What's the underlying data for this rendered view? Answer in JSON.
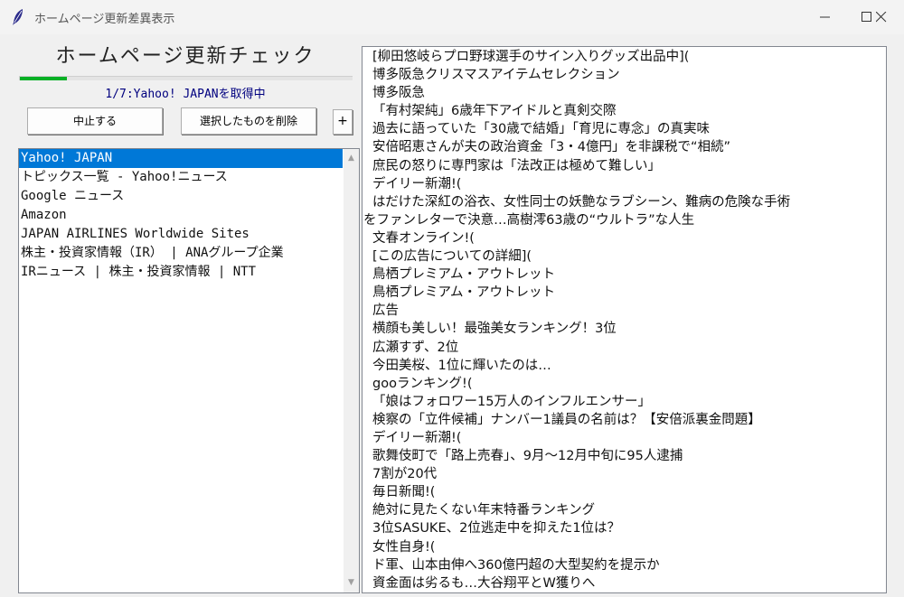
{
  "window": {
    "title": "ホームページ更新差異表示",
    "icon": "feather-icon"
  },
  "heading": "ホームページ更新チェック",
  "progress": {
    "value": 0.14,
    "color": "#06b025"
  },
  "status": "1/7:Yahoo! JAPANを取得中",
  "buttons": {
    "stop": "中止する",
    "delete": "選択したものを削除",
    "add": "+"
  },
  "sites": [
    "Yahoo! JAPAN",
    "トピックス一覧 - Yahoo!ニュース",
    "Google ニュース",
    "Amazon",
    "JAPAN AIRLINES Worldwide Sites",
    "株主・投資家情報（IR） | ANAグループ企業",
    "IRニュース | 株主・投資家情報 | NTT"
  ],
  "selected_site_index": 0,
  "diff_lines": [
    "[柳田悠岐らプロ野球選手のサイン入りグッズ出品中](",
    "博多阪急クリスマスアイテムセレクション",
    "博多阪急",
    "「有村架純」6歳年下アイドルと真剣交際",
    "過去に語っていた「30歳で結婚」「育児に専念」の真実味",
    "安倍昭恵さんが夫の政治資金「3・4億円」を非課税で“相続”",
    "庶民の怒りに専門家は「法改正は極めて難しい」",
    "デイリー新潮!(",
    "はだけた深紅の浴衣、女性同士の妖艶なラブシーン、難病の危険な手術",
    "をファンレターで決意…高樹澪63歳の“ウルトラ”な人生",
    "文春オンライン!(",
    "[この広告についての詳細](",
    "鳥栖プレミアム・アウトレット",
    "鳥栖プレミアム・アウトレット",
    "広告",
    "横顔も美しい！最強美女ランキング！3位",
    "広瀬すず、2位",
    "今田美桜、1位に輝いたのは…",
    "gooランキング!(",
    "「娘はフォロワー15万人のインフルエンサー」",
    "検察の「立件候補」ナンバー1議員の名前は？【安倍派裏金問題】",
    "デイリー新潮!(",
    "歌舞伎町で「路上売春」、9月～12月中旬に95人逮捕",
    "7割が20代",
    "毎日新聞!(",
    "絶対に見たくない年末特番ランキング",
    "3位SASUKE、2位逃走中を抑えた1位は？",
    "女性自身!(",
    "ド軍、山本由伸へ360億円超の大型契約を提示か",
    "資金面は劣るも…大谷翔平とW獲りへ"
  ],
  "wrapped_line_index": 9
}
